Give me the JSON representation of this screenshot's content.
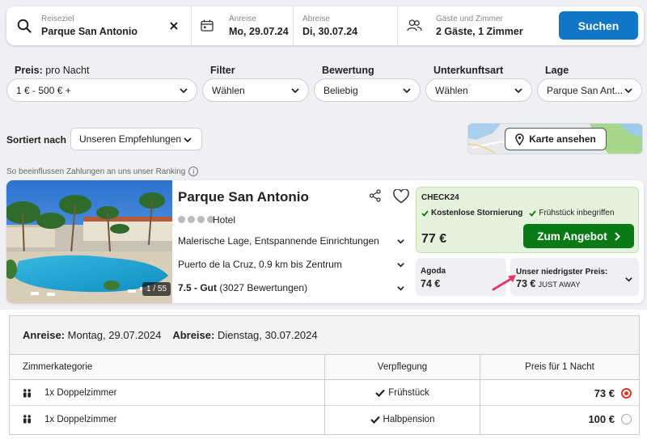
{
  "search": {
    "destination_label": "Reiseziel",
    "destination_value": "Parque San Antonio",
    "checkin_label": "Anreise",
    "checkin_value": "Mo, 29.07.24",
    "checkout_label": "Abreise",
    "checkout_value": "Di, 30.07.24",
    "guests_label": "Gäste und Zimmer",
    "guests_value": "2 Gäste, 1 Zimmer",
    "search_button": "Suchen"
  },
  "filters": {
    "price_label": "Preis:",
    "price_sub": "pro Nacht",
    "price_value": "1 € - 500 € +",
    "filter_label": "Filter",
    "filter_value": "Wählen",
    "rating_label": "Bewertung",
    "rating_value": "Beliebig",
    "type_label": "Unterkunftsart",
    "type_value": "Wählen",
    "location_label": "Lage",
    "location_value": "Parque San Ant..."
  },
  "sort": {
    "label": "Sortiert nach",
    "value": "Unseren Empfehlungen",
    "map_button": "Karte ansehen",
    "ranking_info": "So beeinflussen Zahlungen an uns unser Ranking",
    "info_glyph": "i"
  },
  "hotel": {
    "photo_counter": "1 / 55",
    "name": "Parque San Antonio",
    "type": "Hotel",
    "stars": 4,
    "highlights": "Malerische Lage, Entspannende Einrichtungen",
    "location": "Puerto de la Cruz, 0.9 km bis Zentrum",
    "rating_score": "7.5 - Gut",
    "rating_count": "(3027 Bewertungen)"
  },
  "offers": {
    "main_provider": "CHECK24",
    "tag_cancel": "Kostenlose Stornierung",
    "tag_breakfast": "Frühstück inbegriffen",
    "main_price": "77 €",
    "deal_button": "Zum Angebot",
    "alt_provider": "Agoda",
    "alt_price": "74 €",
    "lowest_label": "Unser niedrigster Preis:",
    "lowest_price": "73 €",
    "lowest_source": "JUST AWAY"
  },
  "booking": {
    "checkin_label": "Anreise:",
    "checkin_value": "Montag, 29.07.2024",
    "checkout_label": "Abreise:",
    "checkout_value": "Dienstag, 30.07.2024",
    "col_room": "Zimmerkategorie",
    "col_meal": "Verpflegung",
    "col_price": "Preis für 1 Nacht",
    "rows": [
      {
        "room": "1x Doppelzimmer",
        "meal": "Frühstück",
        "price": "73 €",
        "selected": true
      },
      {
        "room": "1x Doppelzimmer",
        "meal": "Halbpension",
        "price": "100 €",
        "selected": false
      }
    ]
  },
  "colors": {
    "primary_blue": "#1176c6",
    "deal_green": "#0a7a17",
    "highlight_green_bg": "#e5f3dc",
    "arrow_pink": "#e8336b",
    "radio_red": "#d93a2b"
  }
}
